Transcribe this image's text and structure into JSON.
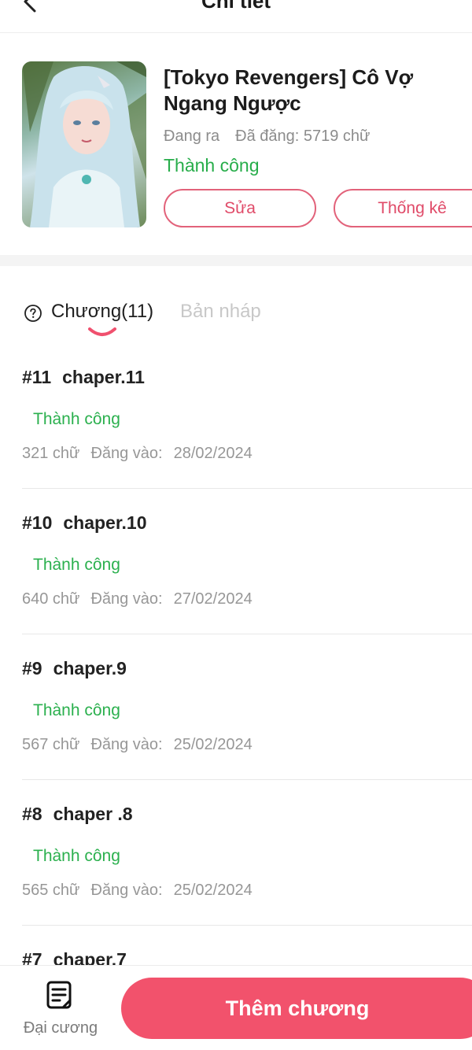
{
  "header": {
    "title": "Chi tiết"
  },
  "book": {
    "title": "[Tokyo Revengers] Cô Vợ Ngang Ngược",
    "state": "Đang ra",
    "word_count": "Đã đăng: 5719 chữ",
    "status": "Thành công",
    "edit_label": "Sửa",
    "stats_label": "Thống kê"
  },
  "tabs": {
    "chapters_label": "Chương(11)",
    "drafts_label": "Bản nháp"
  },
  "chapters": [
    {
      "num": "#11",
      "name": "chaper.11",
      "status": "Thành công",
      "words": "321 chữ",
      "posted_label": "Đăng vào:",
      "date": "28/02/2024"
    },
    {
      "num": "#10",
      "name": "chaper.10",
      "status": "Thành công",
      "words": "640 chữ",
      "posted_label": "Đăng vào:",
      "date": "27/02/2024"
    },
    {
      "num": "#9",
      "name": "chaper.9",
      "status": "Thành công",
      "words": "567 chữ",
      "posted_label": "Đăng vào:",
      "date": "25/02/2024"
    },
    {
      "num": "#8",
      "name": "chaper .8",
      "status": "Thành công",
      "words": "565 chữ",
      "posted_label": "Đăng vào:",
      "date": "25/02/2024"
    },
    {
      "num": "#7",
      "name": "chaper.7"
    }
  ],
  "bottom": {
    "outline_label": "Đại cương",
    "add_chapter_label": "Thêm chương"
  },
  "colors": {
    "accent": "#f2526c",
    "success": "#27ad4a",
    "muted": "#979797"
  },
  "icons": {
    "back": "chevron-left-icon",
    "help": "question-circle-icon",
    "outline": "document-icon"
  }
}
